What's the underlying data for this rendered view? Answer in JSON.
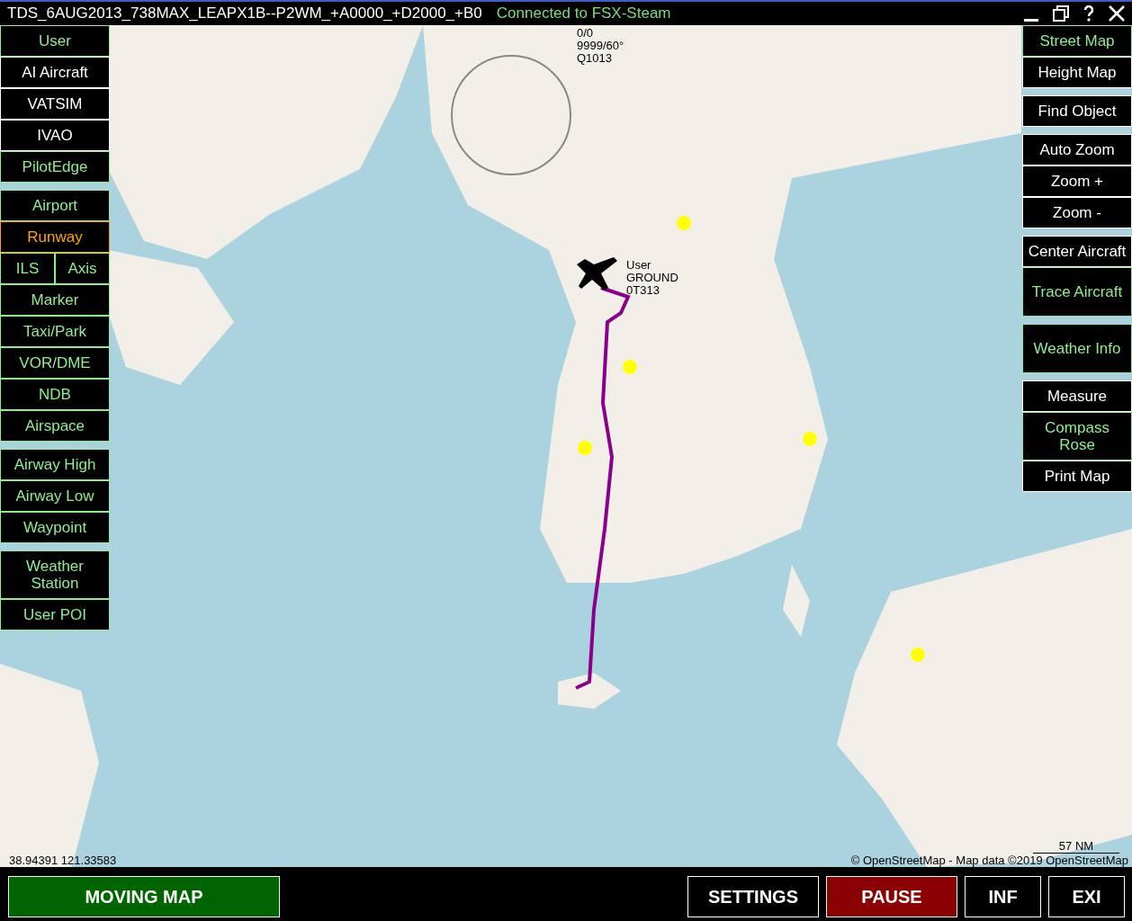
{
  "window": {
    "title": "TDS_6AUG2013_738MAX_LEAPX1B--P2WM_+A0000_+D2000_+B0",
    "connection": "Connected to FSX-Steam"
  },
  "left_panel": {
    "groups": [
      {
        "buttons": [
          {
            "kind": "single",
            "label": "User",
            "on": true,
            "highlighted": false
          },
          {
            "kind": "single",
            "label": "AI Aircraft",
            "on": false,
            "highlighted": false
          },
          {
            "kind": "single",
            "label": "VATSIM",
            "on": false,
            "highlighted": false
          },
          {
            "kind": "single",
            "label": "IVAO",
            "on": false,
            "highlighted": false
          },
          {
            "kind": "single",
            "label": "PilotEdge",
            "on": true,
            "highlighted": false
          }
        ]
      },
      {
        "buttons": [
          {
            "kind": "single",
            "label": "Airport",
            "on": true,
            "highlighted": false
          },
          {
            "kind": "single",
            "label": "Runway",
            "on": true,
            "highlighted": true
          },
          {
            "kind": "pair",
            "items": [
              {
                "label": "ILS",
                "on": true,
                "highlighted": false
              },
              {
                "label": "Axis",
                "on": true,
                "highlighted": false
              }
            ]
          },
          {
            "kind": "single",
            "label": "Marker",
            "on": true,
            "highlighted": false
          },
          {
            "kind": "single",
            "label": "Taxi/Park",
            "on": true,
            "highlighted": false
          },
          {
            "kind": "single",
            "label": "VOR/DME",
            "on": true,
            "highlighted": false
          },
          {
            "kind": "single",
            "label": "NDB",
            "on": true,
            "highlighted": false
          },
          {
            "kind": "single",
            "label": "Airspace",
            "on": true,
            "highlighted": false
          }
        ]
      },
      {
        "buttons": [
          {
            "kind": "single",
            "label": "Airway High",
            "on": true,
            "highlighted": false
          },
          {
            "kind": "single",
            "label": "Airway Low",
            "on": true,
            "highlighted": false
          },
          {
            "kind": "single",
            "label": "Waypoint",
            "on": true,
            "highlighted": false
          }
        ]
      },
      {
        "buttons": [
          {
            "kind": "single",
            "label": "Weather Station",
            "on": true,
            "highlighted": false
          },
          {
            "kind": "single",
            "label": "User POI",
            "on": true,
            "highlighted": false
          }
        ]
      }
    ]
  },
  "right_panel": {
    "groups": [
      {
        "buttons": [
          {
            "kind": "single",
            "label": "Street Map",
            "on": true,
            "highlighted": false
          },
          {
            "kind": "single",
            "label": "Height Map",
            "on": false,
            "highlighted": false
          }
        ]
      },
      {
        "buttons": [
          {
            "kind": "single",
            "label": "Find Object",
            "on": false,
            "highlighted": false
          }
        ]
      },
      {
        "buttons": [
          {
            "kind": "single",
            "label": "Auto Zoom",
            "on": false,
            "highlighted": false
          },
          {
            "kind": "single",
            "label": "Zoom +",
            "on": false,
            "highlighted": false
          },
          {
            "kind": "single",
            "label": "Zoom -",
            "on": false,
            "highlighted": false
          }
        ]
      },
      {
        "buttons": [
          {
            "kind": "single",
            "label": "Center Aircraft",
            "on": false,
            "highlighted": false
          },
          {
            "kind": "tall",
            "label": "Trace Aircraft",
            "on": true,
            "highlighted": false
          }
        ]
      },
      {
        "buttons": [
          {
            "kind": "tall",
            "label": "Weather Info",
            "on": true,
            "highlighted": false
          }
        ]
      },
      {
        "buttons": [
          {
            "kind": "single",
            "label": "Measure",
            "on": false,
            "highlighted": false
          },
          {
            "kind": "single",
            "label": "Compass Rose",
            "on": true,
            "highlighted": false
          },
          {
            "kind": "single",
            "label": "Print Map",
            "on": false,
            "highlighted": false
          }
        ]
      }
    ]
  },
  "map": {
    "weather_label": [
      "0/0",
      "9999/60°",
      "Q1013"
    ],
    "aircraft_label": [
      "User",
      "GROUND",
      "0T313"
    ],
    "coordinates": "38.94391 121.33583",
    "scale": "57 NM",
    "attribution": "© OpenStreetMap - Map data ©2019 OpenStreetMap"
  },
  "bottom_bar": {
    "buttons": [
      {
        "label": "MOVING MAP",
        "color": "#006400"
      },
      {
        "label": "SETTINGS",
        "color": "#000000"
      },
      {
        "label": "PAUSE",
        "color": "#8b0000"
      },
      {
        "label": "INF",
        "color": "#000000"
      },
      {
        "label": "EXI",
        "color": "#000000"
      }
    ]
  }
}
